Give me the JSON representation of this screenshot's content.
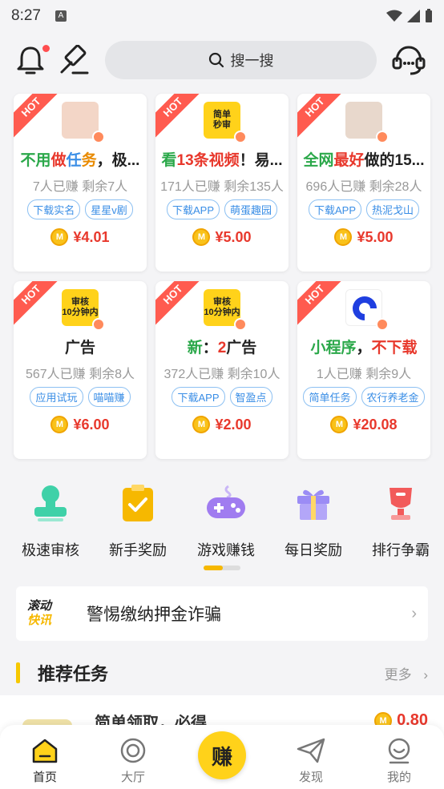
{
  "status": {
    "time": "8:27",
    "notif_icon": "A"
  },
  "header": {
    "search_placeholder": "搜一搜"
  },
  "tasks": [
    {
      "title_parts": [
        "不用",
        "做",
        "任",
        "务",
        "，极..."
      ],
      "title_colors": [
        "#2ba84a",
        "#e8382c",
        "#3a8ee6",
        "#e88a00",
        "#222"
      ],
      "stats": "7人已赚  剩余7人",
      "tags": [
        "下载实名",
        "星星v剧"
      ],
      "price": "¥4.01",
      "hot": "HOT",
      "thumb_color": "#f3d6c7"
    },
    {
      "title_parts": [
        "看",
        "13条视频",
        "！易..."
      ],
      "title_colors": [
        "#2ba84a",
        "#e8382c",
        "#222"
      ],
      "stats": "171人已赚  剩余135人",
      "tags": [
        "下载APP",
        "萌蛋趣园"
      ],
      "price": "¥5.00",
      "hot": "HOT",
      "thumb_text": "简单\n秒审",
      "thumb_color": "#ffd21a"
    },
    {
      "title_parts": [
        "全网",
        "最好",
        "做的15..."
      ],
      "title_colors": [
        "#2ba84a",
        "#e8382c",
        "#222"
      ],
      "stats": "696人已赚  剩余28人",
      "tags": [
        "下载APP",
        "热泥戈山"
      ],
      "price": "¥5.00",
      "hot": "HOT",
      "thumb_color": "#e8d8cc"
    },
    {
      "title_parts": [
        "广告"
      ],
      "title_colors": [
        "#222"
      ],
      "stats": "567人已赚  剩余8人",
      "tags": [
        "应用试玩",
        "喵喵赚"
      ],
      "price": "¥6.00",
      "hot": "HOT",
      "thumb_text": "审核\n10分钟内",
      "thumb_color": "#ffd21a"
    },
    {
      "title_parts": [
        "新",
        "：",
        "2",
        "广告"
      ],
      "title_colors": [
        "#2ba84a",
        "#222",
        "#e8382c",
        "#222"
      ],
      "stats": "372人已赚  剩余10人",
      "tags": [
        "下载APP",
        "智盈点"
      ],
      "price": "¥2.00",
      "hot": "HOT",
      "thumb_text": "审核\n10分钟内",
      "thumb_color": "#ffd21a"
    },
    {
      "title_parts": [
        "小程序",
        "，",
        "不下载"
      ],
      "title_colors": [
        "#2ba84a",
        "#222",
        "#e8382c"
      ],
      "stats": "1人已赚  剩余9人",
      "tags": [
        "简单任务",
        "农行养老金"
      ],
      "price": "¥20.08",
      "hot": "HOT",
      "thumb_color": "#ffffff"
    }
  ],
  "features": [
    {
      "label": "极速审核",
      "icon": "stamp-icon",
      "color": "#3fd1a8"
    },
    {
      "label": "新手奖励",
      "icon": "clipboard-check-icon",
      "color": "#f6b800"
    },
    {
      "label": "游戏赚钱",
      "icon": "gamepad-icon",
      "color": "#a07cf0"
    },
    {
      "label": "每日奖励",
      "icon": "gift-icon",
      "color": "#9b8cf5"
    },
    {
      "label": "排行争霸",
      "icon": "trophy-icon",
      "color": "#f25a5a"
    }
  ],
  "notice": {
    "tag_line1": "滚动",
    "tag_line2": "快讯",
    "text": "警惕缴纳押金诈骗"
  },
  "section": {
    "title": "推荐任务",
    "more": "更多"
  },
  "peek": {
    "title": "简单领取，必得",
    "price": "0.80"
  },
  "tabs": [
    {
      "label": "首页",
      "icon": "home-icon",
      "active": true
    },
    {
      "label": "大厅",
      "icon": "target-icon",
      "active": false
    },
    {
      "label": "赚",
      "icon": "earn-icon",
      "active": false
    },
    {
      "label": "发现",
      "icon": "paper-plane-icon",
      "active": false
    },
    {
      "label": "我的",
      "icon": "smile-icon",
      "active": false
    }
  ],
  "coin_symbol": "M"
}
